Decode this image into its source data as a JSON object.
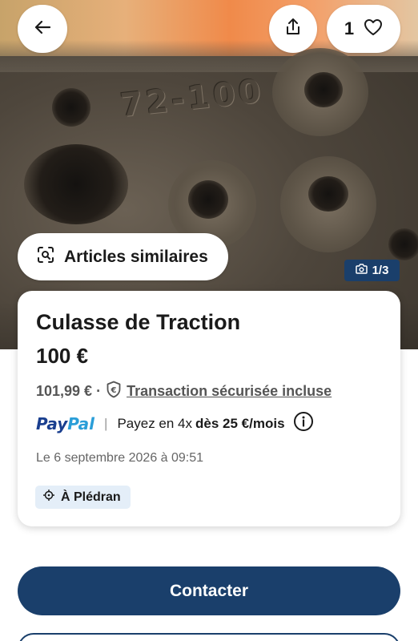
{
  "photo": {
    "casting_text": "72-100",
    "counter": "1/3"
  },
  "top_bar": {
    "favorites_count": "1"
  },
  "similar": {
    "label": "Articles similaires"
  },
  "listing": {
    "title": "Culasse de Traction",
    "price": "100 €",
    "protected_price": "101,99 € ·",
    "protection_link": "Transaction sécurisée incluse",
    "paypal_pay": "Pay",
    "paypal_pal": "Pal",
    "paypal_separator": "|",
    "paypal_text": "Payez en 4x",
    "paypal_bold": "dès 25 €/mois",
    "date": "Le 6 septembre 2026 à 09:51",
    "location": "À Plédran"
  },
  "actions": {
    "contact_label": "Contacter"
  },
  "colors": {
    "primary": "#1a3f6b",
    "paypal_dark": "#1a3f8f",
    "paypal_light": "#2a9ed8",
    "location_bg": "#e4eef8"
  },
  "icons": {
    "back": "arrow-left-icon",
    "share": "share-icon",
    "favorite": "heart-icon",
    "similar": "visual-search-icon",
    "camera": "camera-icon",
    "protection": "euro-shield-icon",
    "info": "info-icon",
    "location": "location-pin-icon"
  }
}
